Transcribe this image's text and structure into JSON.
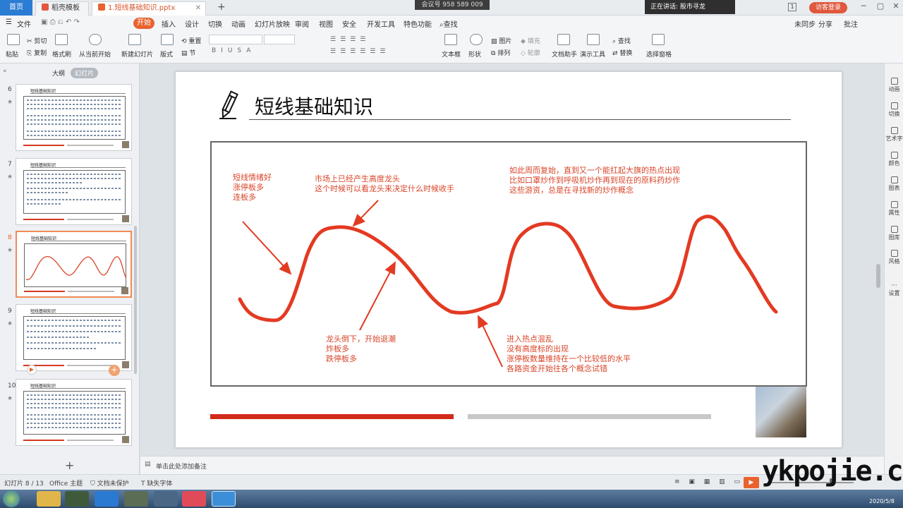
{
  "tabs": [
    {
      "label": "首页"
    },
    {
      "label": "稻壳模板"
    },
    {
      "label": "1.短线基础知识.pptx"
    }
  ],
  "meeting": "会议号 958 589 009",
  "speaking": "正在讲话: 股市寻龙",
  "visitor_login": "访客登录",
  "page_badge": "1",
  "menu": [
    "文件",
    "开始",
    "插入",
    "设计",
    "切换",
    "动画",
    "幻灯片放映",
    "审阅",
    "视图",
    "安全",
    "开发工具",
    "特色功能",
    "查找"
  ],
  "menu_right": [
    "未同步",
    "分享",
    "批注"
  ],
  "ribbon": {
    "paste": "粘贴",
    "cut": "剪切",
    "copy": "复制",
    "format_painter": "格式刷",
    "from_current": "从当前开始",
    "new_slide": "新建幻灯片",
    "layout": "版式",
    "reset": "重置",
    "section": "节",
    "text_box": "文本框",
    "shape": "形状",
    "arrange": "排列",
    "picture": "图片",
    "fill": "填充",
    "outline": "轮廓",
    "doc_assistant": "文档助手",
    "presentation_tools": "演示工具",
    "find": "查找",
    "replace": "替换",
    "select_pane": "选择窗格"
  },
  "panel_tabs": [
    "大纲",
    "幻灯片"
  ],
  "thumbs": [
    {
      "num": "6",
      "title": "短线基础知识"
    },
    {
      "num": "7",
      "title": "短线基础知识"
    },
    {
      "num": "8",
      "title": "短线基础知识"
    },
    {
      "num": "9",
      "title": "短线基础知识"
    },
    {
      "num": "10",
      "title": "短线基础知识"
    }
  ],
  "slide": {
    "title": "短线基础知识",
    "notes": {
      "n1": [
        "短线情绪好",
        "涨停板多",
        "连板多"
      ],
      "n2": [
        "市场上已经产生高度龙头",
        "这个时候可以看龙头来决定什么时候收手"
      ],
      "n3": [
        "如此周而复始，直到又一个能扛起大旗的热点出现",
        "比如口罩炒作到呼吸机炒作再到现在的原料药炒作",
        "这些游资，总是在寻找新的炒作概念"
      ],
      "n4": [
        "龙头倒下，开始退潮",
        "炸板多",
        "跌停板多"
      ],
      "n5": [
        "进入热点混乱",
        "没有高度标的出现",
        "涨停板数量维持在一个比较低的水平",
        "各路资金开始往各个概念试错"
      ]
    }
  },
  "rightrail": [
    "动画",
    "切换",
    "艺术字",
    "颜色",
    "图表",
    "属性",
    "图库",
    "风格",
    "设置"
  ],
  "notes_placeholder": "单击此处添加备注",
  "status": {
    "slide_count": "幻灯片 8 / 13",
    "theme": "Office 主题",
    "protect": "文档未保护",
    "missing_font": "缺失字体"
  },
  "clock": {
    "date": "2020/5/8"
  },
  "watermark": "ykpojie.com",
  "colors": {
    "accent": "#e9622f",
    "note_red": "#d9452a",
    "bar_red": "#d22a1a"
  }
}
